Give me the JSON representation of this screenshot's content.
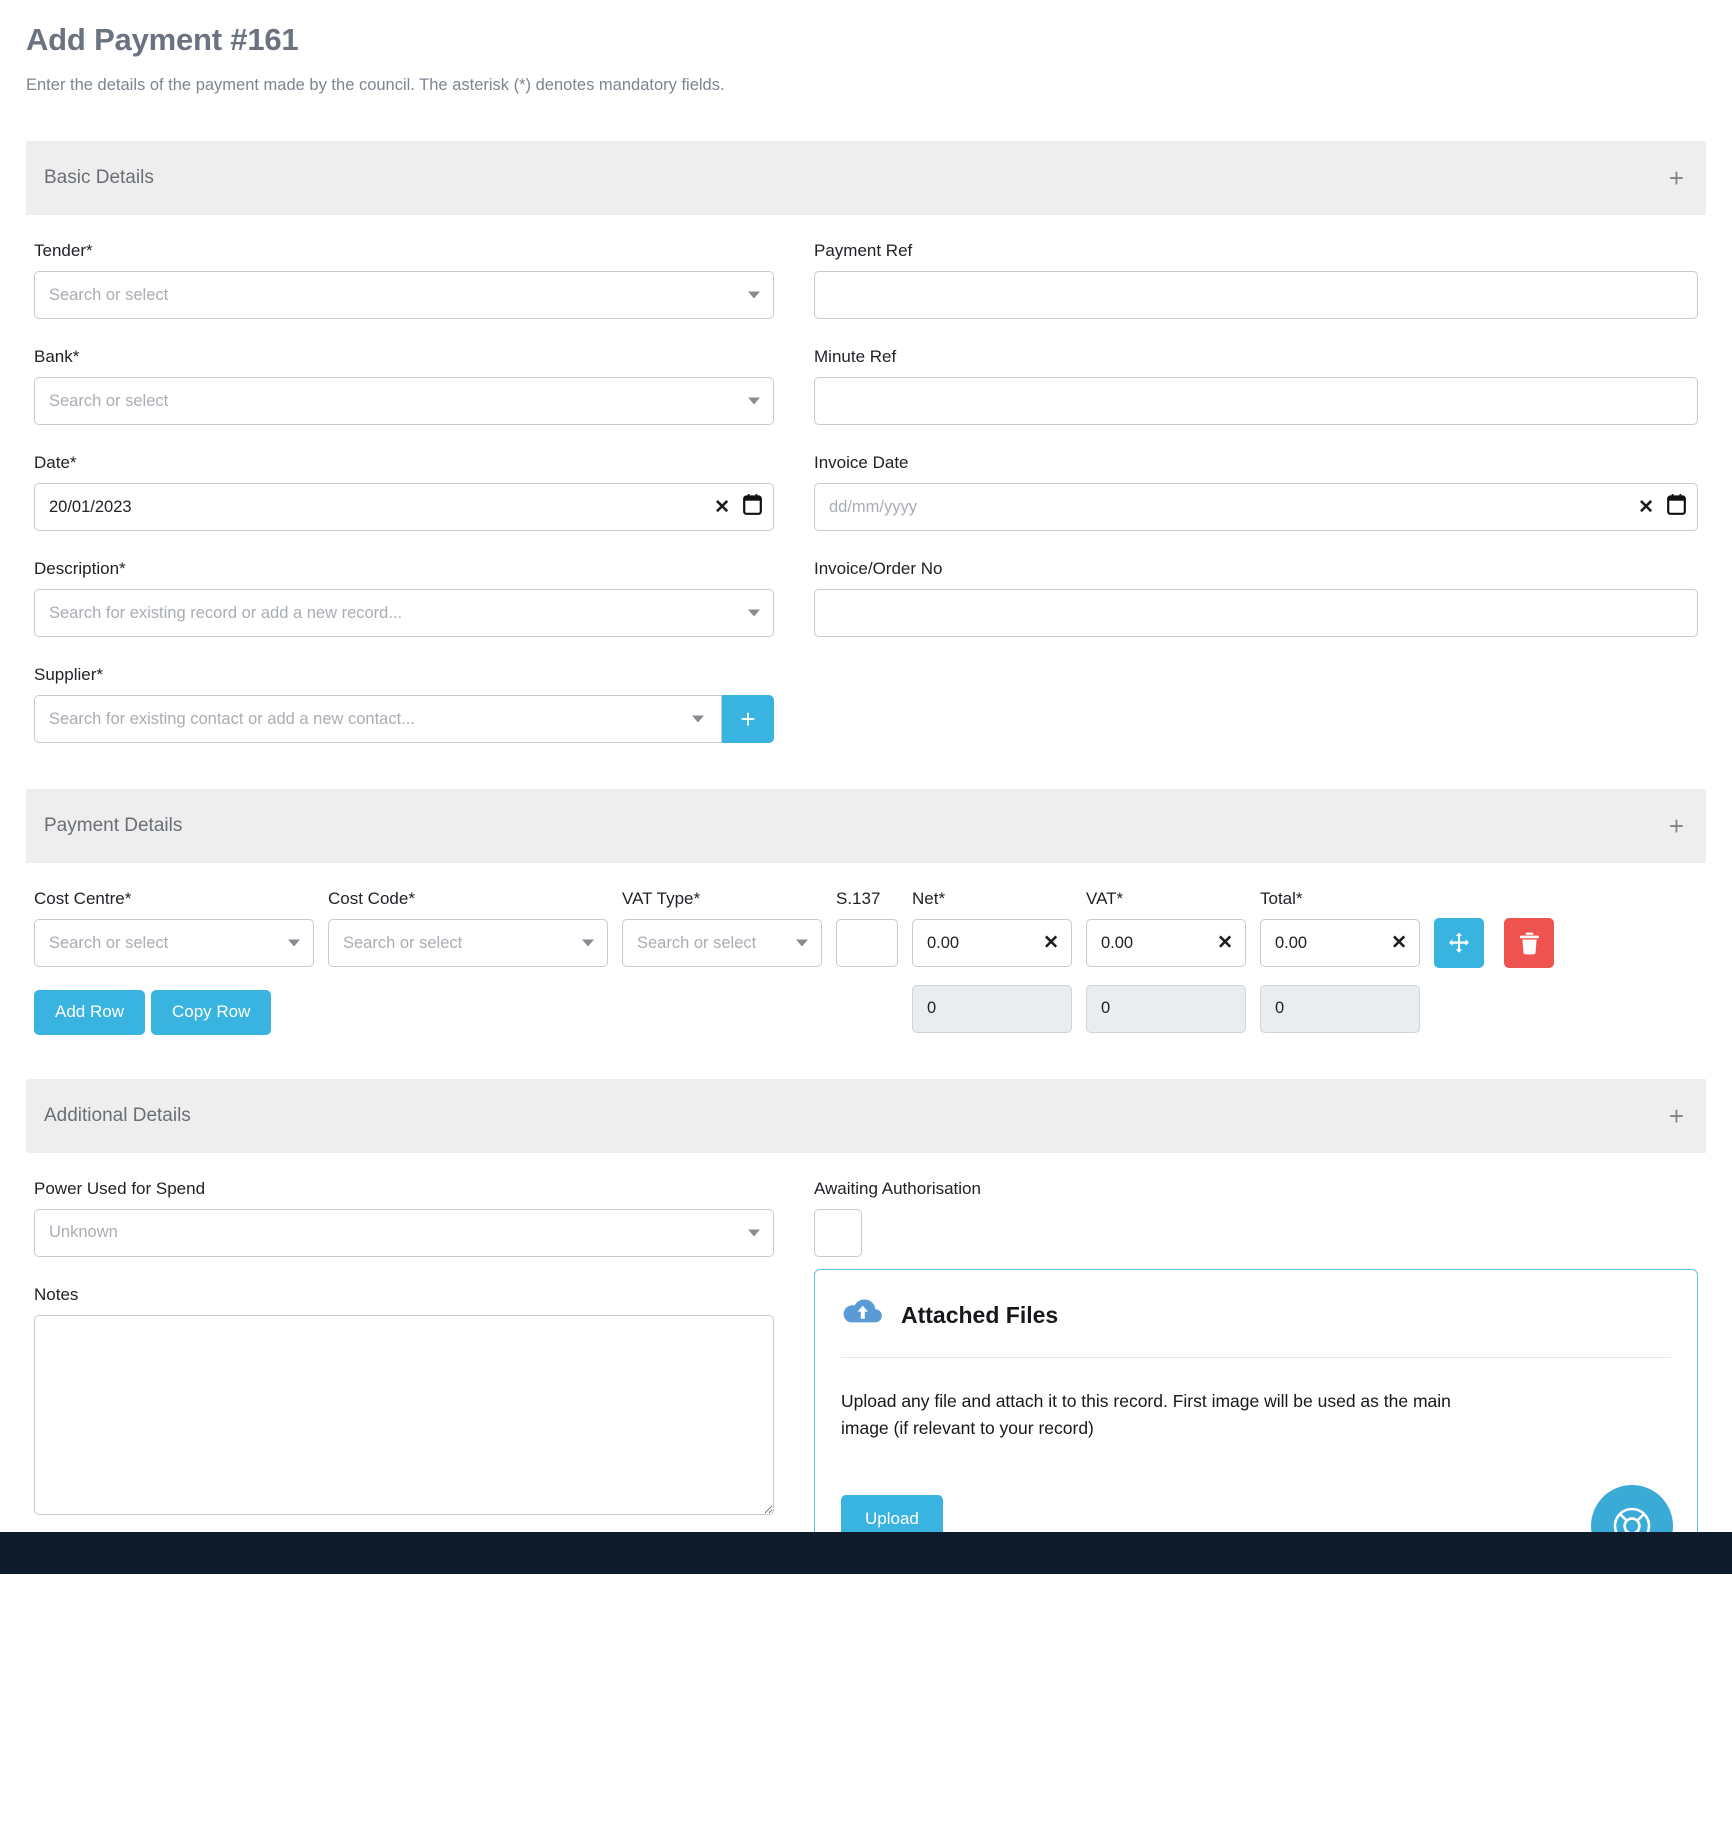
{
  "header": {
    "title": "Add Payment #161",
    "subtitle": "Enter the details of the payment made by the council. The asterisk (*) denotes mandatory fields."
  },
  "sections": {
    "basic": {
      "title": "Basic Details",
      "expand_icon": "+"
    },
    "payment": {
      "title": "Payment Details",
      "expand_icon": "+"
    },
    "additional": {
      "title": "Additional Details",
      "expand_icon": "+"
    }
  },
  "basic_details": {
    "tender": {
      "label": "Tender*",
      "placeholder": "Search or select",
      "value": ""
    },
    "bank": {
      "label": "Bank*",
      "placeholder": "Search or select",
      "value": ""
    },
    "date": {
      "label": "Date*",
      "value": "20/01/2023",
      "placeholder": "dd/mm/yyyy"
    },
    "description": {
      "label": "Description*",
      "placeholder": "Search for existing record or add a new record...",
      "value": ""
    },
    "supplier": {
      "label": "Supplier*",
      "placeholder": "Search for existing contact or add a new contact...",
      "value": "",
      "add_label": "+"
    },
    "payment_ref": {
      "label": "Payment Ref",
      "placeholder": "",
      "value": ""
    },
    "minute_ref": {
      "label": "Minute Ref",
      "placeholder": "",
      "value": ""
    },
    "invoice_date": {
      "label": "Invoice Date",
      "value": "",
      "placeholder": "dd/mm/yyyy"
    },
    "invoice_order_no": {
      "label": "Invoice/Order No",
      "placeholder": "",
      "value": ""
    }
  },
  "payment_details": {
    "columns": [
      "Cost Centre*",
      "Cost Code*",
      "VAT Type*",
      "S.137",
      "Net*",
      "VAT*",
      "Total*"
    ],
    "row": {
      "cost_centre": {
        "placeholder": "Search or select",
        "value": ""
      },
      "cost_code": {
        "placeholder": "Search or select",
        "value": ""
      },
      "vat_type": {
        "placeholder": "Search or select",
        "value": ""
      },
      "s137": {
        "value": ""
      },
      "net": {
        "value": "0.00"
      },
      "vat": {
        "value": "0.00"
      },
      "total": {
        "value": "0.00"
      }
    },
    "buttons": {
      "add_row": "Add Row",
      "copy_row": "Copy Row"
    },
    "totals": {
      "net": "0",
      "vat": "0",
      "total": "0"
    }
  },
  "additional_details": {
    "power_used": {
      "label": "Power Used for Spend",
      "value": "Unknown",
      "placeholder": "Unknown"
    },
    "awaiting_auth": {
      "label": "Awaiting Authorisation",
      "checked": false
    },
    "notes": {
      "label": "Notes",
      "value": "",
      "placeholder": ""
    }
  },
  "attached_files": {
    "title": "Attached Files",
    "description": "Upload any file and attach it to this record. First image will be used as the main image (if relevant to your record)",
    "upload_label": "Upload"
  },
  "colors": {
    "accent": "#39b3e0",
    "danger": "#ef5350",
    "section_bg": "#eeeeee",
    "title": "#6b7280"
  }
}
